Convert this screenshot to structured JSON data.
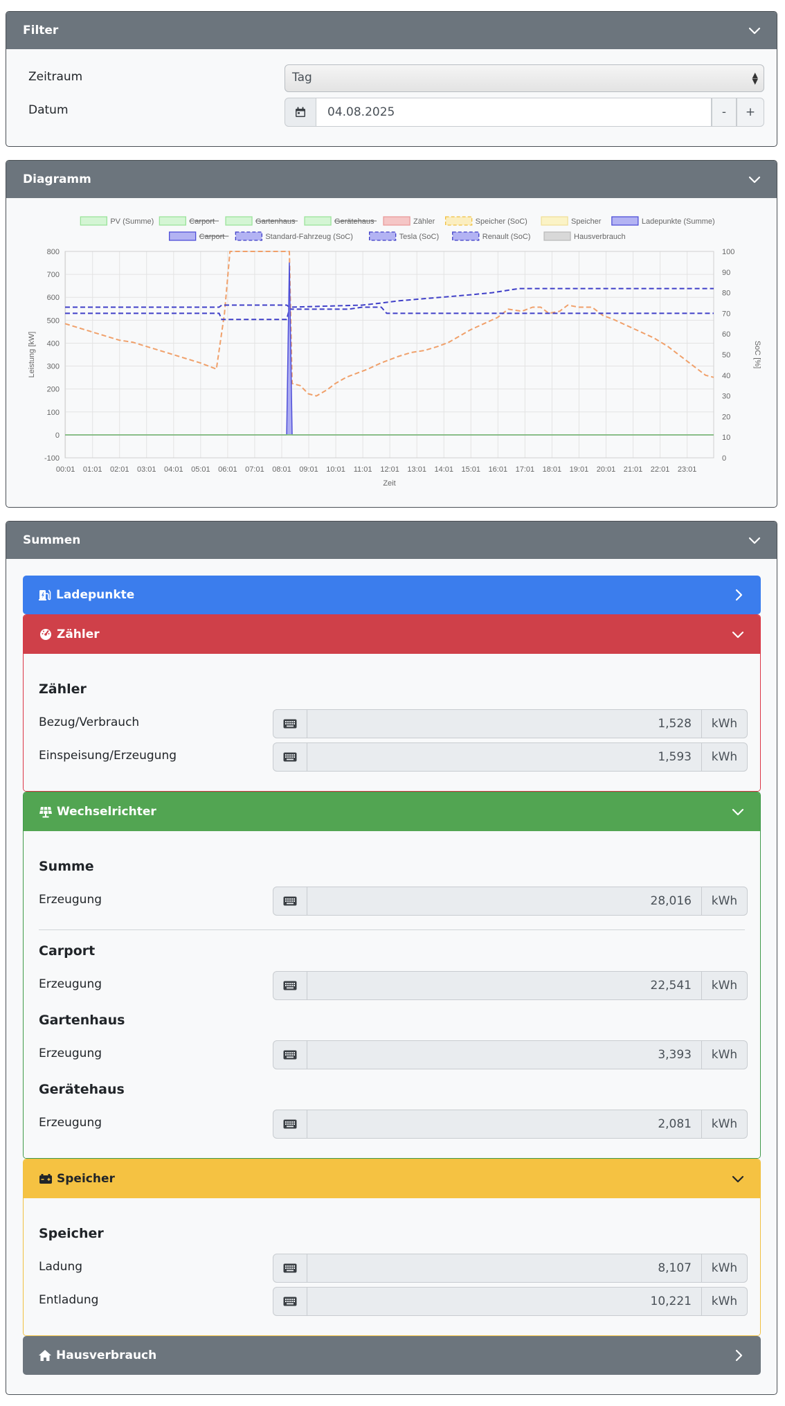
{
  "filter": {
    "title": "Filter",
    "zeitraum_label": "Zeitraum",
    "zeitraum_value": "Tag",
    "datum_label": "Datum",
    "datum_value": "04.08.2025",
    "minus": "-",
    "plus": "+"
  },
  "diagram": {
    "title": "Diagramm"
  },
  "chart_data": {
    "type": "line",
    "legend": [
      {
        "name": "PV (Summe)",
        "color": "#9be39b",
        "fill": "#d4f5d4",
        "dashed": false,
        "hidden": false
      },
      {
        "name": "Carport",
        "color": "#9be39b",
        "fill": "#d4f5d4",
        "dashed": false,
        "hidden": true
      },
      {
        "name": "Gartenhaus",
        "color": "#9be39b",
        "fill": "#d4f5d4",
        "dashed": false,
        "hidden": true
      },
      {
        "name": "Gerätehaus",
        "color": "#9be39b",
        "fill": "#d4f5d4",
        "dashed": false,
        "hidden": true
      },
      {
        "name": "Zähler",
        "color": "#e99a9a",
        "fill": "#f5c6c6",
        "dashed": false,
        "hidden": false
      },
      {
        "name": "Speicher (SoC)",
        "color": "#f0c040",
        "fill": "#fbeec0",
        "dashed": true,
        "hidden": false
      },
      {
        "name": "Speicher",
        "color": "#f0e09a",
        "fill": "#fbf3c6",
        "dashed": false,
        "hidden": false
      },
      {
        "name": "Ladepunkte (Summe)",
        "color": "#4f4fd8",
        "fill": "#b3b3f3",
        "dashed": false,
        "hidden": false
      },
      {
        "name": "Carport",
        "color": "#4f4fd8",
        "fill": "#b3b3f3",
        "dashed": false,
        "hidden": true
      },
      {
        "name": "Standard-Fahrzeug (SoC)",
        "color": "#3f3fc8",
        "fill": "#b3b3f3",
        "dashed": true,
        "hidden": false
      },
      {
        "name": "Tesla (SoC)",
        "color": "#3f3fc8",
        "fill": "#b3b3f3",
        "dashed": true,
        "hidden": false
      },
      {
        "name": "Renault (SoC)",
        "color": "#3f3fc8",
        "fill": "#b3b3f3",
        "dashed": true,
        "hidden": false
      },
      {
        "name": "Hausverbrauch",
        "color": "#bbbbbb",
        "fill": "#d8d8d8",
        "dashed": false,
        "hidden": false
      }
    ],
    "x_ticks": [
      "00:01",
      "01:01",
      "02:01",
      "03:01",
      "04:01",
      "05:01",
      "06:01",
      "07:01",
      "08:01",
      "09:01",
      "10:01",
      "11:01",
      "12:01",
      "13:01",
      "14:01",
      "15:01",
      "16:01",
      "17:01",
      "18:01",
      "19:01",
      "20:01",
      "21:01",
      "22:01",
      "23:01"
    ],
    "xlabel": "Zeit",
    "ylabel_left": "Leistung [kW]",
    "ylabel_right": "SoC [%]",
    "ylim_left": [
      -100,
      800
    ],
    "ylim_right": [
      0,
      100
    ],
    "y_ticks_left": [
      -100,
      0,
      100,
      200,
      300,
      400,
      500,
      600,
      700,
      800
    ],
    "y_ticks_right": [
      0,
      10,
      20,
      30,
      40,
      50,
      60,
      70,
      80,
      90,
      100
    ],
    "x_range_hours": [
      0,
      24
    ],
    "series": [
      {
        "name": "Speicher (SoC)",
        "axis": "right",
        "color": "#f0a06a",
        "dashed": true,
        "points": [
          [
            0,
            65
          ],
          [
            0.5,
            63
          ],
          [
            1,
            61
          ],
          [
            1.5,
            59
          ],
          [
            2,
            57
          ],
          [
            2.5,
            56
          ],
          [
            3,
            54
          ],
          [
            3.5,
            52
          ],
          [
            4,
            50
          ],
          [
            4.5,
            48
          ],
          [
            5,
            46
          ],
          [
            5.6,
            43
          ],
          [
            5.9,
            70
          ],
          [
            6.1,
            100
          ],
          [
            8.3,
            100
          ],
          [
            8.4,
            36
          ],
          [
            8.7,
            35
          ],
          [
            9,
            31
          ],
          [
            9.3,
            30
          ],
          [
            9.7,
            33
          ],
          [
            10,
            36
          ],
          [
            10.4,
            39
          ],
          [
            10.8,
            41
          ],
          [
            11.2,
            43
          ],
          [
            11.7,
            46
          ],
          [
            12.3,
            49
          ],
          [
            12.8,
            51
          ],
          [
            13.3,
            52
          ],
          [
            13.8,
            54
          ],
          [
            14.2,
            56
          ],
          [
            14.6,
            59
          ],
          [
            15,
            62
          ],
          [
            15.5,
            65
          ],
          [
            16,
            68
          ],
          [
            16.4,
            72
          ],
          [
            16.9,
            71
          ],
          [
            17.3,
            73
          ],
          [
            17.6,
            73
          ],
          [
            17.9,
            70
          ],
          [
            18.3,
            71
          ],
          [
            18.6,
            74
          ],
          [
            19,
            73
          ],
          [
            19.5,
            73
          ],
          [
            19.9,
            69
          ],
          [
            20.3,
            67
          ],
          [
            20.8,
            64
          ],
          [
            21.3,
            61
          ],
          [
            21.8,
            58
          ],
          [
            22.3,
            54
          ],
          [
            22.8,
            49
          ],
          [
            23.3,
            44
          ],
          [
            23.7,
            40
          ],
          [
            24,
            39
          ]
        ]
      },
      {
        "name": "Standard-Fahrzeug (SoC)",
        "axis": "right",
        "color": "#3f3fc8",
        "dashed": true,
        "points": [
          [
            0,
            70
          ],
          [
            5.7,
            70
          ],
          [
            5.8,
            67
          ],
          [
            8.2,
            67
          ],
          [
            8.3,
            72
          ],
          [
            10.5,
            72
          ],
          [
            11,
            73
          ],
          [
            11.7,
            73
          ],
          [
            11.9,
            70
          ],
          [
            24,
            70
          ]
        ]
      },
      {
        "name": "Tesla (SoC)",
        "axis": "right",
        "color": "#3f3fc8",
        "dashed": true,
        "points": [
          [
            0,
            73
          ],
          [
            5.7,
            73
          ],
          [
            5.8,
            74
          ],
          [
            8.2,
            74
          ],
          [
            8.3,
            73
          ],
          [
            11,
            74
          ],
          [
            11.7,
            75
          ],
          [
            12.3,
            76
          ],
          [
            13.2,
            77
          ],
          [
            14.1,
            78
          ],
          [
            15,
            79
          ],
          [
            15.8,
            80
          ],
          [
            16.8,
            82
          ],
          [
            24,
            82
          ]
        ]
      },
      {
        "name": "Ladepunkte (Summe)",
        "axis": "left",
        "color": "#4f4fd8",
        "fill": "#9f9ff0",
        "dashed": false,
        "points": [
          [
            0,
            0
          ],
          [
            8.2,
            0
          ],
          [
            8.3,
            750
          ],
          [
            8.4,
            0
          ],
          [
            24,
            0
          ]
        ]
      },
      {
        "name": "Zähler",
        "axis": "left",
        "color": "#b08060",
        "dashed": false,
        "points": [
          [
            0,
            0
          ],
          [
            24,
            0
          ]
        ]
      },
      {
        "name": "PV (Summe)",
        "axis": "left",
        "color": "#7ac47a",
        "dashed": false,
        "points": [
          [
            0,
            0
          ],
          [
            24,
            0
          ]
        ]
      }
    ]
  },
  "summen": {
    "title": "Summen",
    "ladepunkte": {
      "title": "Ladepunkte"
    },
    "zaehler": {
      "title": "Zähler",
      "section": "Zähler",
      "rows": [
        {
          "label": "Bezug/Verbrauch",
          "value": "1,528",
          "unit": "kWh"
        },
        {
          "label": "Einspeisung/Erzeugung",
          "value": "1,593",
          "unit": "kWh"
        }
      ]
    },
    "wechselrichter": {
      "title": "Wechselrichter",
      "summe": {
        "section": "Summe",
        "label": "Erzeugung",
        "value": "28,016",
        "unit": "kWh"
      },
      "carport": {
        "section": "Carport",
        "label": "Erzeugung",
        "value": "22,541",
        "unit": "kWh"
      },
      "gartenhaus": {
        "section": "Gartenhaus",
        "label": "Erzeugung",
        "value": "3,393",
        "unit": "kWh"
      },
      "geraetehaus": {
        "section": "Gerätehaus",
        "label": "Erzeugung",
        "value": "2,081",
        "unit": "kWh"
      }
    },
    "speicher": {
      "title": "Speicher",
      "section": "Speicher",
      "rows": [
        {
          "label": "Ladung",
          "value": "8,107",
          "unit": "kWh"
        },
        {
          "label": "Entladung",
          "value": "10,221",
          "unit": "kWh"
        }
      ]
    },
    "hausverbrauch": {
      "title": "Hausverbrauch"
    }
  }
}
